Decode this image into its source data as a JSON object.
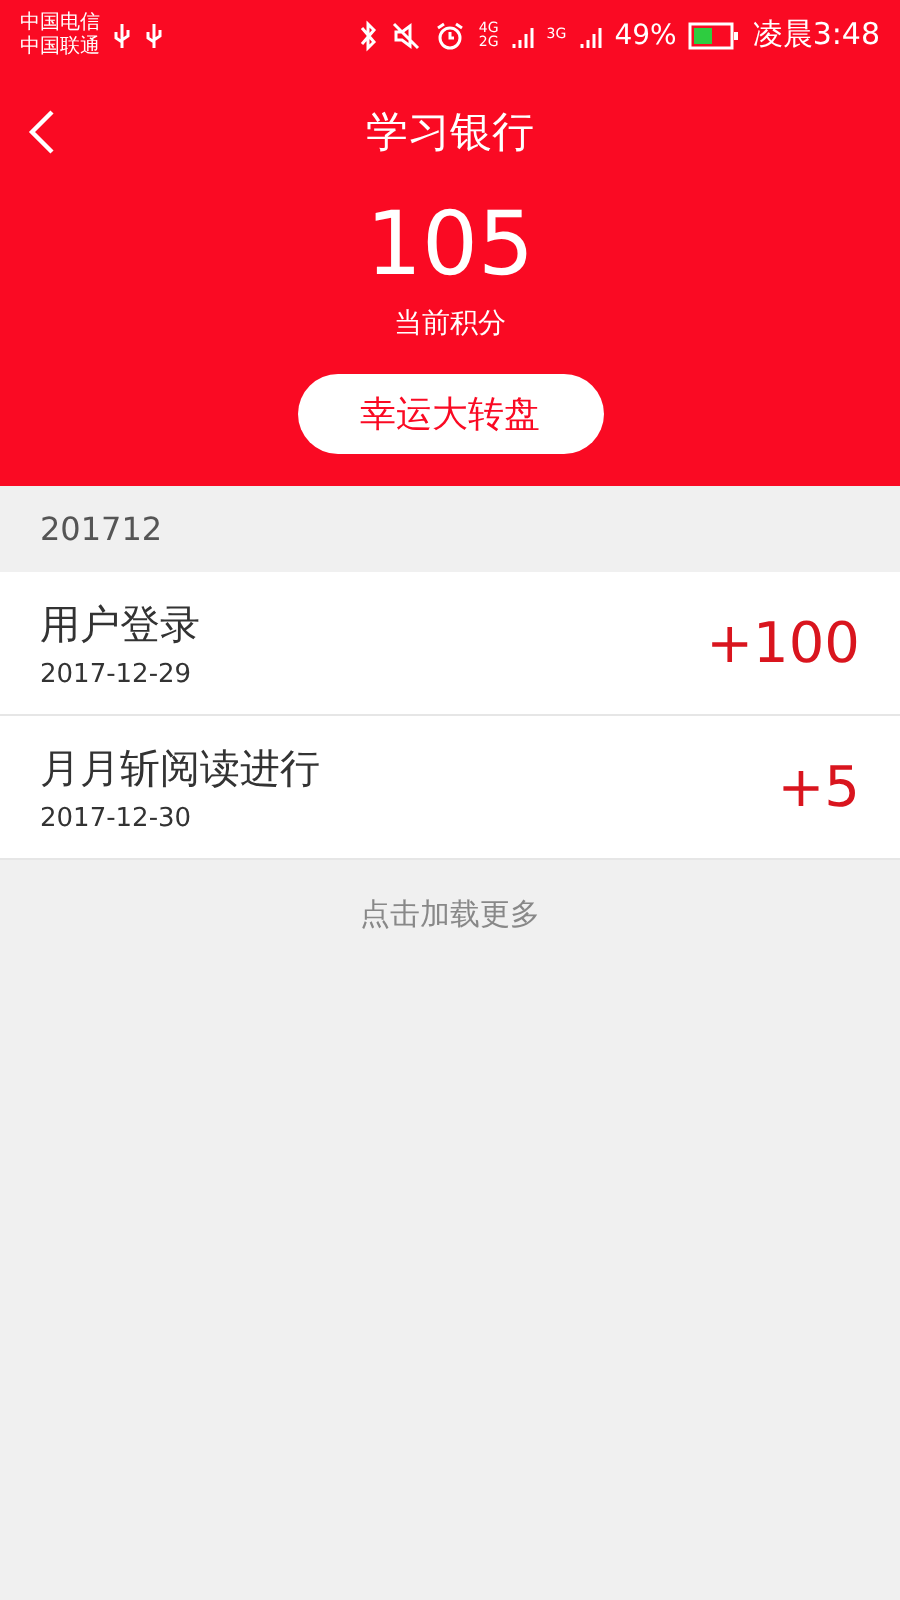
{
  "status_bar": {
    "carriers": [
      "中国电信",
      "中国联通"
    ],
    "network_labels": [
      "4G",
      "2G",
      "3G"
    ],
    "battery": "49%",
    "time": "凌晨3:48"
  },
  "header": {
    "title": "学习银行",
    "points": "105",
    "points_label": "当前积分",
    "action": "幸运大转盘"
  },
  "section": {
    "title": "201712"
  },
  "records": [
    {
      "title": "用户登录",
      "date": "2017-12-29",
      "amount": "+100"
    },
    {
      "title": "月月斩阅读进行",
      "date": "2017-12-30",
      "amount": "+5"
    }
  ],
  "load_more": "点击加载更多"
}
